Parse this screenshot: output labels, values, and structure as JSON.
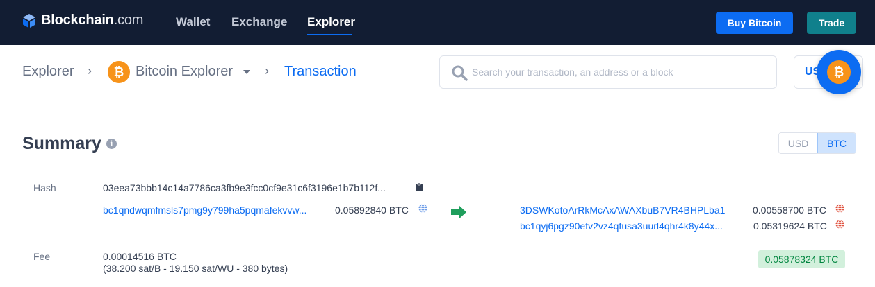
{
  "brand": {
    "name": "Blockchain",
    "suffix": ".com"
  },
  "nav": {
    "wallet": "Wallet",
    "exchange": "Exchange",
    "explorer": "Explorer"
  },
  "actions": {
    "buy": "Buy Bitcoin",
    "trade": "Trade"
  },
  "breadcrumb": {
    "root": "Explorer",
    "chain": "Bitcoin Explorer",
    "current": "Transaction",
    "sep": "›"
  },
  "btc_symbol": "₿",
  "search": {
    "placeholder": "Search your transaction, an address or a block"
  },
  "currency_selector": "USD",
  "summary": {
    "title": "Summary",
    "info": "i",
    "toggle": {
      "usd": "USD",
      "btc": "BTC",
      "selected": "BTC"
    },
    "hash_label": "Hash",
    "hash": "03eea73bbb14c14a7786ca3fb9e3fcc0cf9e31c6f3196e1b7b112f...",
    "inputs": [
      {
        "address": "bc1qndwqmfmsls7pmg9y799ha5pqmafekvvw...",
        "amount": "0.05892840 BTC"
      }
    ],
    "outputs": [
      {
        "address": "3DSWKotoArRkMcAxAWAXbuB7VR4BHPLba1",
        "amount": "0.00558700 BTC"
      },
      {
        "address": "bc1qyj6pgz90efv2vz4qfusa3uurl4qhr4k8y44x...",
        "amount": "0.05319624 BTC"
      }
    ],
    "fee_label": "Fee",
    "fee": "0.00014516 BTC",
    "fee_detail": "(38.200 sat/B - 19.150 sat/WU - 380 bytes)",
    "total_out": "0.05878324 BTC"
  },
  "colors": {
    "nav_bg": "#121d33",
    "accent": "#0c6cf2",
    "trade": "#10808c",
    "btc": "#f7931a",
    "unspent": "#6b9be8",
    "spent": "#e0523f",
    "arrow": "#1f9e5c"
  }
}
